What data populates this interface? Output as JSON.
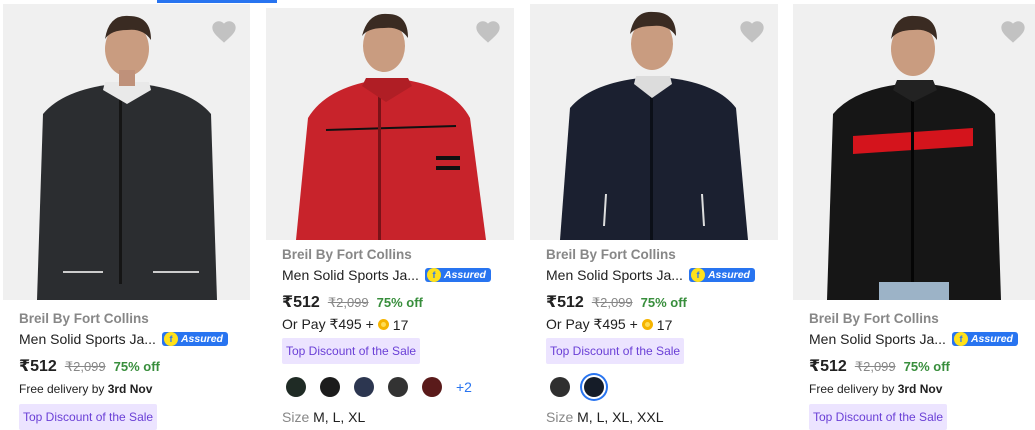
{
  "products": [
    {
      "brand": "Breil By Fort Collins",
      "title": "Men Solid Sports Ja...",
      "assured": "Assured",
      "price": "₹512",
      "mrp": "₹2,099",
      "discount": "75% off",
      "delivery_prefix": "Free delivery by ",
      "delivery_date": "3rd Nov",
      "tag": "Top Discount of the Sale",
      "jacket_color": "#2b2d30",
      "wishlist_icon": "heart-icon"
    },
    {
      "brand": "Breil By Fort Collins",
      "title": "Men Solid Sports Ja...",
      "assured": "Assured",
      "price": "₹512",
      "mrp": "₹2,099",
      "discount": "75% off",
      "or_pay_prefix": "Or Pay ₹495 + ",
      "supercoins": "17",
      "tag": "Top Discount of the Sale",
      "swatches": [
        "#1f2b25",
        "#1c1c1c",
        "#2c3650",
        "#333333",
        "#5a1a1a"
      ],
      "more_colors": "+2",
      "size_label": "Size",
      "sizes": "M, L, XL",
      "jacket_color": "#c8232b",
      "wishlist_icon": "heart-icon"
    },
    {
      "brand": "Breil By Fort Collins",
      "title": "Men Solid Sports Ja...",
      "assured": "Assured",
      "price": "₹512",
      "mrp": "₹2,099",
      "discount": "75% off",
      "or_pay_prefix": "Or Pay ₹495 + ",
      "supercoins": "17",
      "tag": "Top Discount of the Sale",
      "swatches": [
        "#2f2f2f",
        "#151c28"
      ],
      "selected_swatch": 1,
      "size_label": "Size",
      "sizes": "M, L, XL, XXL",
      "jacket_color": "#1b2030",
      "wishlist_icon": "heart-icon"
    },
    {
      "brand": "Breil By Fort Collins",
      "title": "Men Solid Sports Ja...",
      "assured": "Assured",
      "price": "₹512",
      "mrp": "₹2,099",
      "discount": "75% off",
      "delivery_prefix": "Free delivery by ",
      "delivery_date": "3rd Nov",
      "tag": "Top Discount of the Sale",
      "jacket_color": "#161616",
      "stripe_color": "#d4141c",
      "wishlist_icon": "heart-icon"
    }
  ],
  "colors": {
    "accent": "#2874f0",
    "discount_green": "#388e3c",
    "tag_bg": "#ece4ff",
    "tag_text": "#6a3fd6"
  }
}
